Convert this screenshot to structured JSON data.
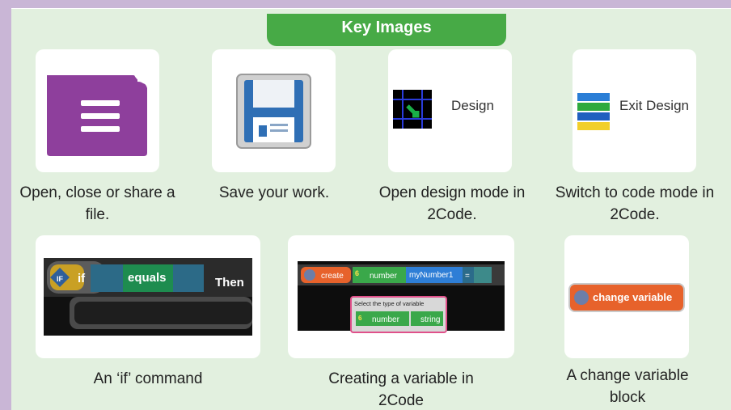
{
  "header": {
    "title": "Key Images"
  },
  "cards": {
    "open": {
      "caption": "Open, close or share a file.",
      "icon": "file-menu-icon"
    },
    "save": {
      "caption": "Save your work.",
      "icon": "floppy-disk-icon"
    },
    "design": {
      "label": "Design",
      "caption": "Open design mode in 2Code.",
      "icon": "design-grid-icon"
    },
    "exit_design": {
      "label": "Exit Design",
      "caption": "Switch to code mode in 2Code.",
      "icon": "code-blocks-icon"
    },
    "if_cmd": {
      "if_label": "if",
      "equals_label": "equals",
      "then_label": "Then",
      "caption": "An ‘if’ command"
    },
    "create_var": {
      "create_label": "create",
      "six": "6",
      "number_label": "number",
      "var_name": "myNumber1",
      "eq": "=",
      "prompt": "Select the type of variable",
      "opt_number": "number",
      "opt_string": "string",
      "caption": "Creating a variable in 2Code"
    },
    "change_var": {
      "label": "change variable",
      "caption": "A change variable block"
    }
  },
  "colors": {
    "header": "#47aa46",
    "background": "#e2f0df",
    "border": "#c9b6d6",
    "purple": "#8e3f9c",
    "orange": "#e7622b"
  }
}
